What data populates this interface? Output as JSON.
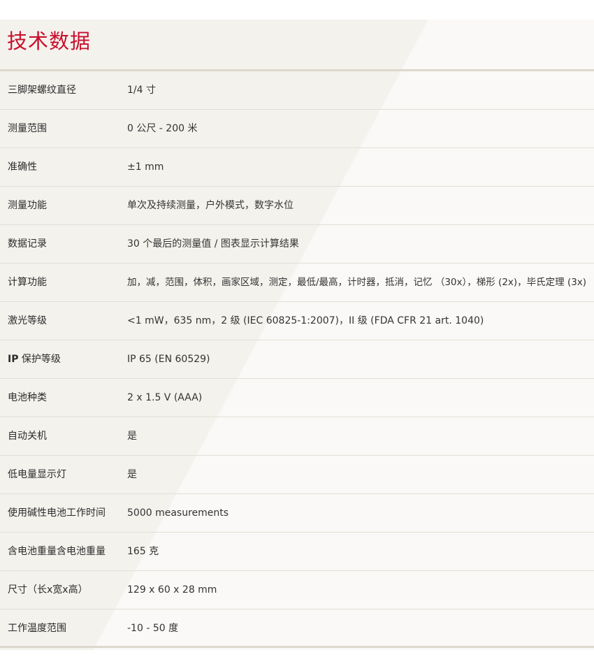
{
  "title": "技术数据",
  "specs": [
    {
      "label": "三脚架螺纹直径",
      "value": "1/4 寸"
    },
    {
      "label": "测量范围",
      "value": "0 公尺 - 200 米"
    },
    {
      "label": "准确性",
      "value": "±1 mm"
    },
    {
      "label": "测量功能",
      "value": "单次及持续测量，户外模式，数字水位"
    },
    {
      "label": "数据记录",
      "value": "30 个最后的测量值 / 图表显示计算结果"
    },
    {
      "label": "计算功能",
      "value": "加，减，范围，体积，画家区域，测定，最低/最高，计时器，抵消，记忆 （30x），梯形 (2x)，毕氏定理 (3x)"
    },
    {
      "label": "激光等级",
      "value": "<1 mW，635 nm，2 级 (IEC 60825-1:2007)，II 级 (FDA CFR 21 art. 1040)"
    },
    {
      "label_lead": "IP",
      "label": " 保护等级",
      "value": "IP 65 (EN 60529)"
    },
    {
      "label": "电池种类",
      "value": "2 x 1.5 V (AAA)"
    },
    {
      "label": "自动关机",
      "value": "是"
    },
    {
      "label": "低电量显示灯",
      "value": "是"
    },
    {
      "label": "使用碱性电池工作时间",
      "value": "5000 measurements"
    },
    {
      "label": "含电池重量含电池重量",
      "value": "165 克"
    },
    {
      "label": "尺寸（长x宽x高）",
      "value": "129 x 60 x 28 mm"
    },
    {
      "label": "工作温度范围",
      "value": "-10 - 50 度"
    }
  ]
}
